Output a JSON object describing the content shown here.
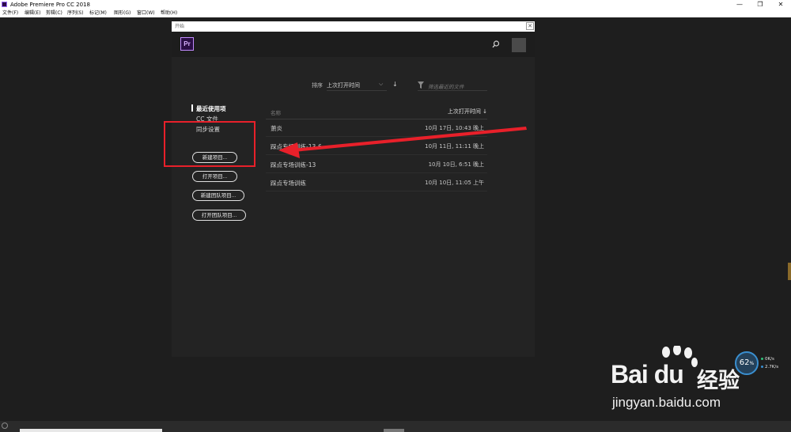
{
  "window": {
    "title": "Adobe Premiere Pro CC 2018",
    "controls": {
      "minimize": "—",
      "restore": "❐",
      "close": "✕"
    }
  },
  "menubar": {
    "items": [
      "文件(F)",
      "编辑(E)",
      "剪辑(C)",
      "序列(S)",
      "标记(M)",
      "图形(G)",
      "窗口(W)",
      "帮助(H)"
    ]
  },
  "dialog": {
    "title": "开始",
    "app_logo": "Pr",
    "icons": {
      "search": "search-icon",
      "account": "avatar"
    },
    "sort": {
      "label": "排序",
      "value": "上次打开时间",
      "chevron": "⌵",
      "direction": "↓"
    },
    "filter_placeholder": "筛选最近的文件",
    "nav": [
      {
        "label": "最近使用项",
        "active": true
      },
      {
        "label": "CC 文件",
        "active": false
      },
      {
        "label": "同步设置",
        "active": false
      }
    ],
    "buttons": [
      "新建项目...",
      "打开项目...",
      "新建团队项目...",
      "打开团队项目..."
    ],
    "table": {
      "columns": [
        "名称",
        "上次打开时间 ↓"
      ],
      "rows": [
        {
          "name": "萧炎",
          "date": "10月 17日, 10:43 晚上"
        },
        {
          "name": "踩点专场训练-13-6",
          "date": "10月 11日, 11:11 晚上"
        },
        {
          "name": "踩点专场训练-13",
          "date": "10月 10日, 6:51 晚上"
        },
        {
          "name": "踩点专场训练",
          "date": "10月 10日, 11:05 上午"
        }
      ]
    }
  },
  "annotation": {
    "color": "#e8202a"
  },
  "network_widget": {
    "percent": "62",
    "percent_unit": "%",
    "up": "0K/s",
    "down": "2.7K/s",
    "colors": {
      "up": "#2fc27a",
      "down": "#3a8fd0"
    }
  },
  "watermark": {
    "brand": "Bai du",
    "brand_cn": "经验",
    "url": "jingyan.baidu.com"
  }
}
